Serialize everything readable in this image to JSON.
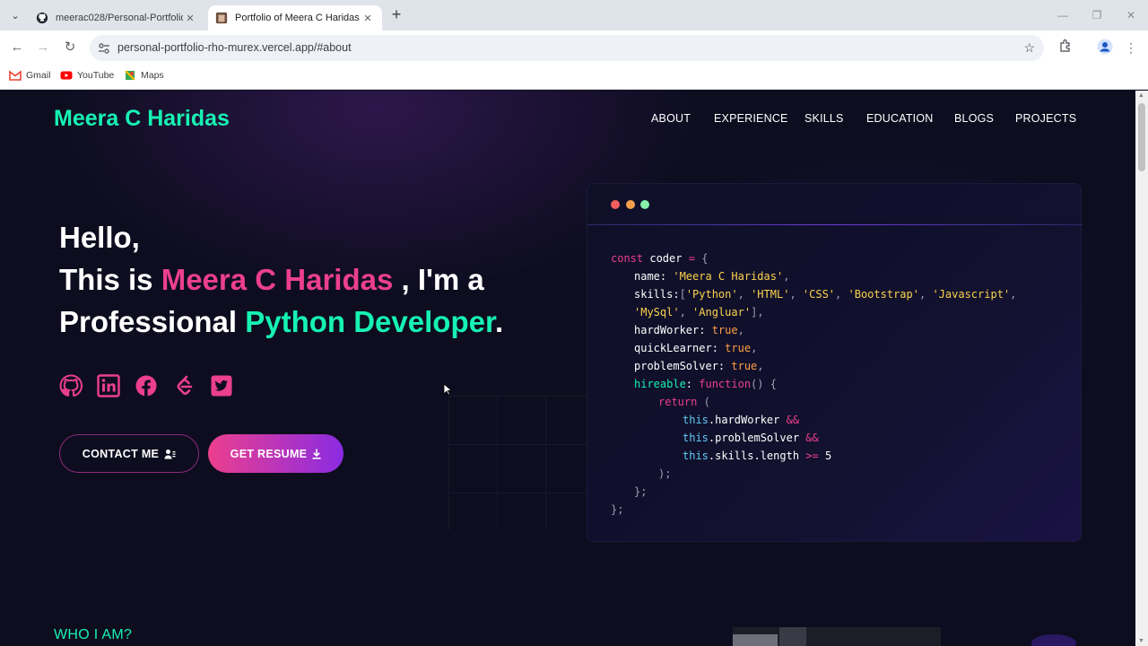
{
  "browser": {
    "tabs": [
      {
        "title": "meerac028/Personal-Portfolio",
        "icon": "github-icon",
        "active": false
      },
      {
        "title": "Portfolio of Meera C Haridas - I",
        "icon": "site-favicon",
        "active": true
      }
    ],
    "url": "personal-portfolio-rho-murex.vercel.app/#about",
    "bookmarks": [
      {
        "label": "Gmail",
        "icon": "gmail-icon"
      },
      {
        "label": "YouTube",
        "icon": "youtube-icon"
      },
      {
        "label": "Maps",
        "icon": "maps-icon"
      }
    ]
  },
  "site": {
    "brand": "Meera C Haridas",
    "nav": [
      "ABOUT",
      "EXPERIENCE",
      "SKILLS",
      "EDUCATION",
      "BLOGS",
      "PROJECTS"
    ],
    "hero": {
      "line1": "Hello,",
      "line2_prefix": "This is ",
      "name": "Meera C Haridas",
      "line2_suffix": " , I'm a",
      "line3_prefix": "Professional ",
      "role": "Python Developer",
      "line3_suffix": "."
    },
    "socials": [
      "github-icon",
      "linkedin-icon",
      "facebook-icon",
      "leetcode-icon",
      "twitter-icon"
    ],
    "buttons": {
      "contact": "CONTACT ME",
      "resume": "GET RESUME"
    },
    "code": {
      "dots": [
        "#f25f5c",
        "#f6a04d",
        "#86efac"
      ],
      "lines": [
        "const coder = {",
        "name: 'Meera C Haridas',",
        "skills:['Python', 'HTML', 'CSS', 'Bootstrap', 'Javascript',",
        "'MySql', 'Angluar'],",
        "hardWorker: true,",
        "quickLearner: true,",
        "problemSolver: true,",
        "hireable: function() {",
        "return (",
        "this.hardWorker &&",
        "this.problemSolver &&",
        "this.skills.length >= 5",
        ");",
        "};",
        "};"
      ]
    },
    "section_title": "WHO I AM?"
  },
  "colors": {
    "accent_green": "#16f2b3",
    "accent_pink": "#ec3f8e",
    "background": "#0d0d1f"
  }
}
